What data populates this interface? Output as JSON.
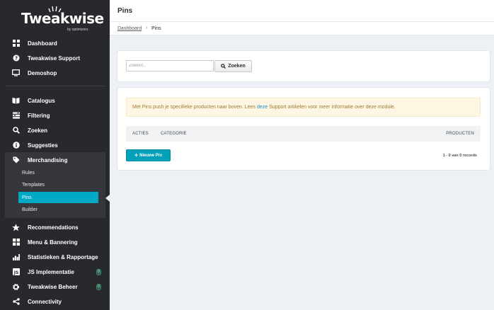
{
  "brand": {
    "name": "Tweakwise",
    "tagline": "by optimizers"
  },
  "sidebar": {
    "top_items": [
      {
        "label": "Dashboard",
        "icon": "dashboard-icon"
      },
      {
        "label": "Tweakwise Support",
        "icon": "help-icon"
      },
      {
        "label": "Demoshop",
        "icon": "monitor-icon"
      }
    ],
    "main_items": [
      {
        "label": "Catalogus",
        "icon": "book-icon"
      },
      {
        "label": "Filtering",
        "icon": "filter-icon"
      },
      {
        "label": "Zoeken",
        "icon": "search-icon"
      },
      {
        "label": "Suggesties",
        "icon": "info-icon"
      },
      {
        "label": "Merchandising",
        "icon": "tag-icon"
      }
    ],
    "merchandising_sub": [
      {
        "label": "Rules"
      },
      {
        "label": "Templates"
      },
      {
        "label": "Pins",
        "active": true
      },
      {
        "label": "Builder"
      }
    ],
    "bottom_items": [
      {
        "label": "Recommendations",
        "icon": "star-icon"
      },
      {
        "label": "Menu & Bannering",
        "icon": "grid-icon"
      },
      {
        "label": "Statistieken & Rapportage",
        "icon": "chart-icon"
      },
      {
        "label": "JS Implementatie",
        "icon": "js-icon",
        "badge": "0"
      },
      {
        "label": "Tweakwise Beheer",
        "icon": "gear-icon",
        "badge": "0"
      },
      {
        "label": "Connectivity",
        "icon": "share-icon"
      }
    ]
  },
  "header": {
    "title": "Pins"
  },
  "breadcrumb": {
    "root": "Dashboard",
    "separator": "›",
    "current": "Pins"
  },
  "search": {
    "placeholder": "Zoeken..",
    "button_label": "Zoeken"
  },
  "info": {
    "text_before": "Met Pins push je specifieke producten naar boven. Lees",
    "link_text": "deze",
    "text_after": "Support artikelen voor meer informatie over deze module."
  },
  "table": {
    "columns": {
      "acties": "ACTIES",
      "categorie": "CATEGORIE",
      "producten": "PRODUCTEN"
    }
  },
  "actions": {
    "new_pin_label": "Nieuwe Pin"
  },
  "records_summary": "1 - 0 van 0 records",
  "colors": {
    "sidebar": "#27292d",
    "accent": "#00a9c4",
    "background": "#edf0f4"
  }
}
